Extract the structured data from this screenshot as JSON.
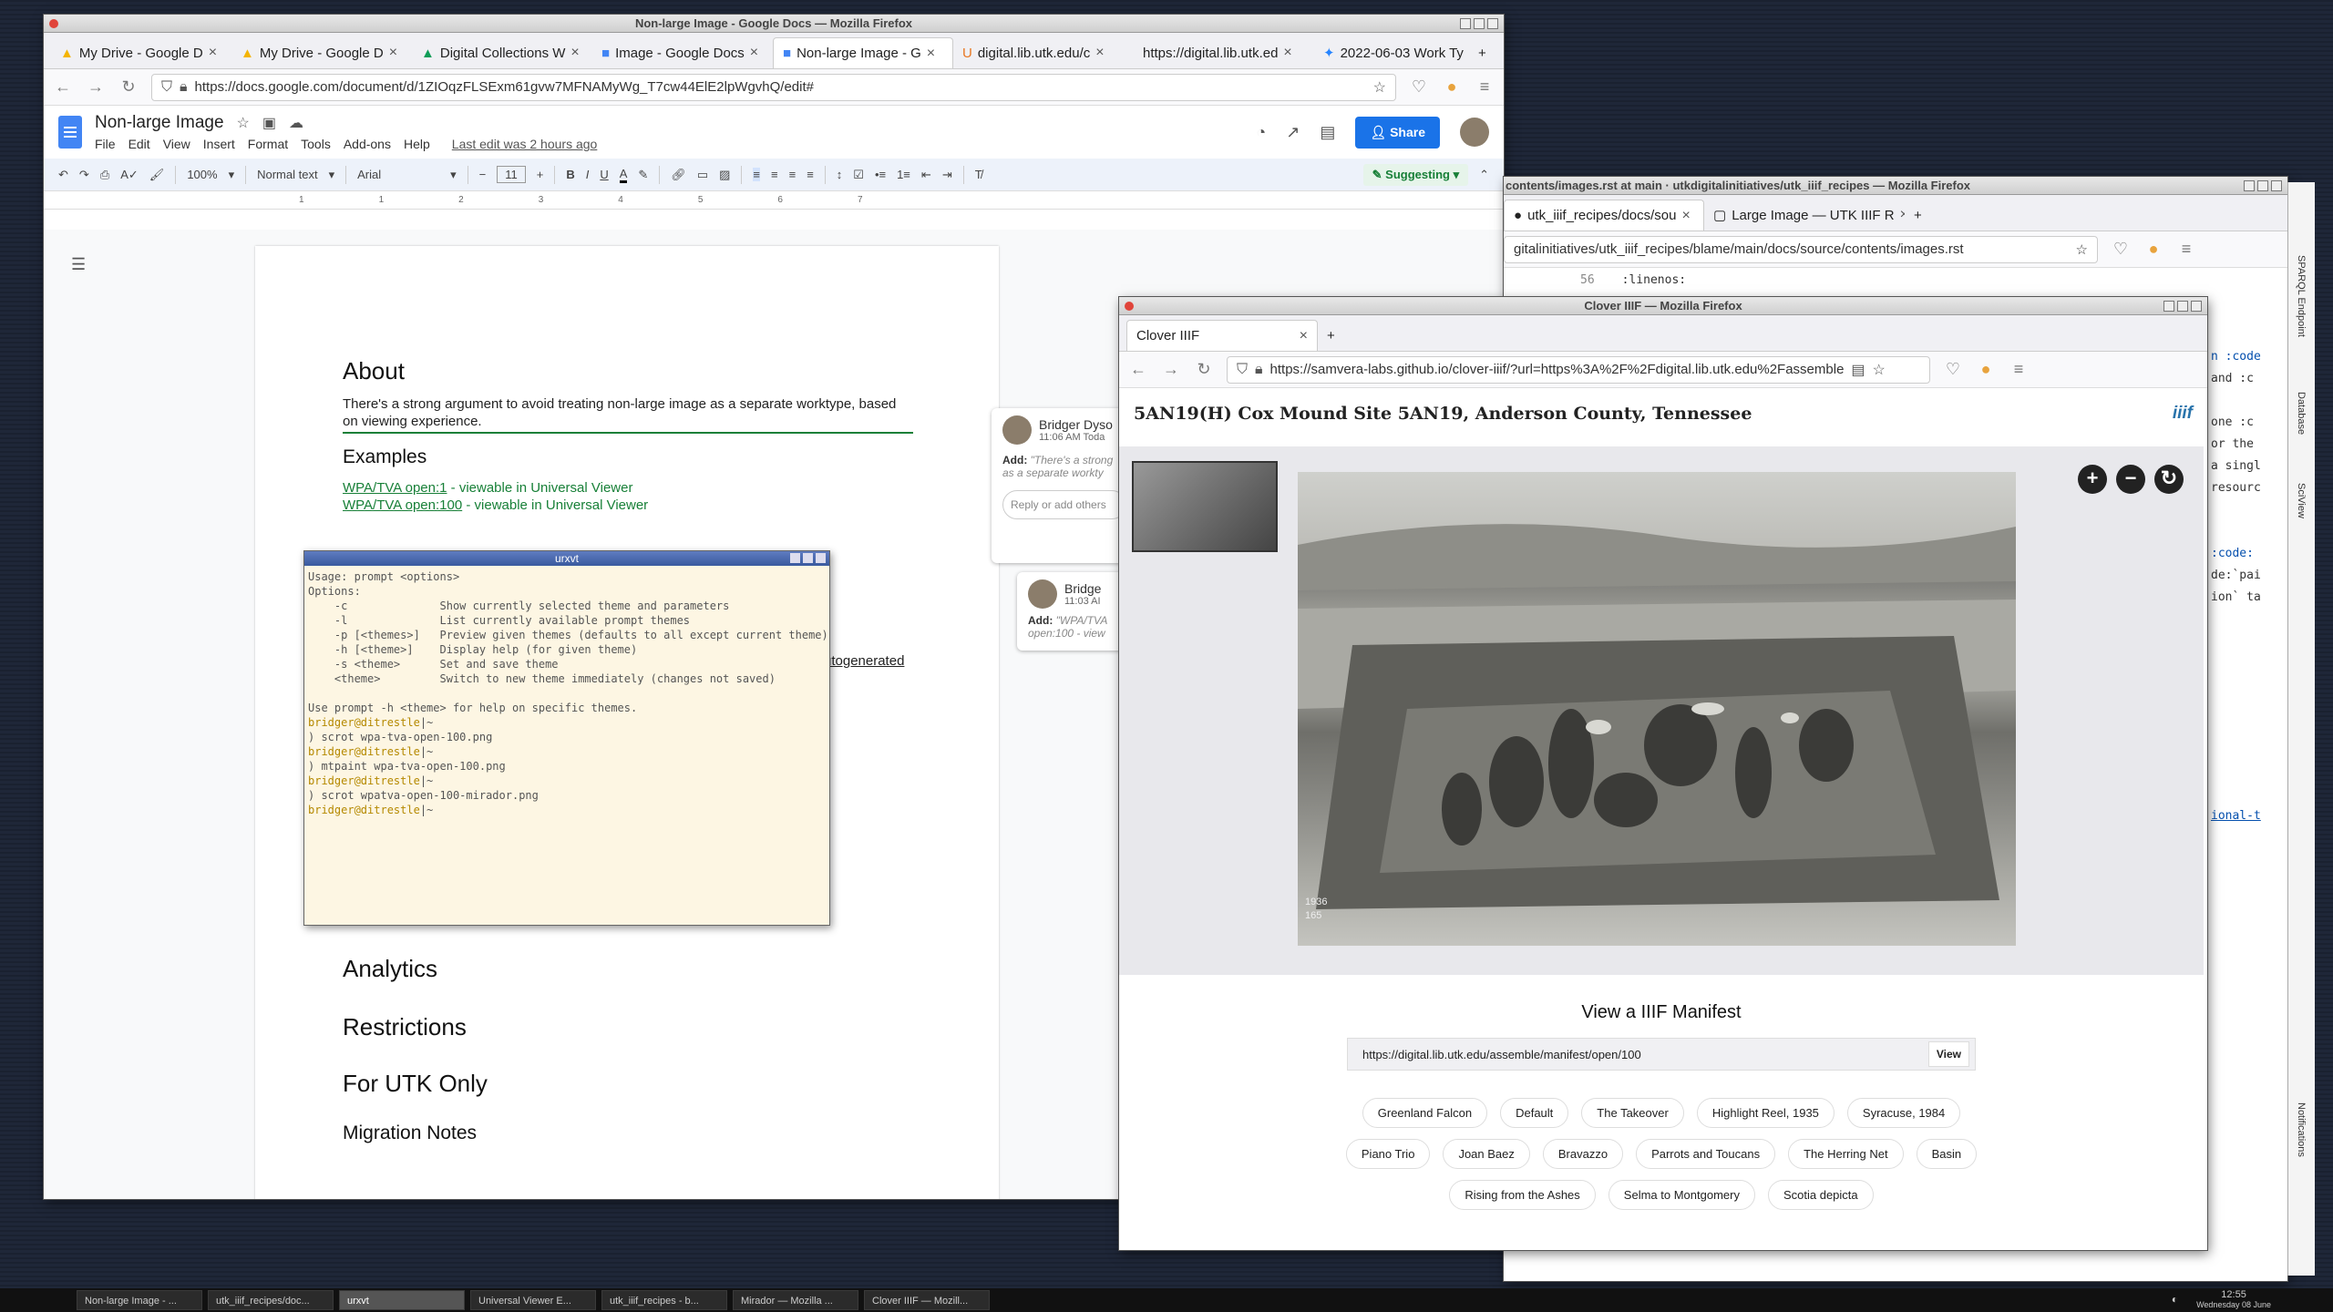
{
  "docs": {
    "window_title": "Non-large Image - Google Docs — Mozilla Firefox",
    "tabs": [
      {
        "label": "My Drive - Google D"
      },
      {
        "label": "My Drive - Google D"
      },
      {
        "label": "Digital Collections W"
      },
      {
        "label": "Image - Google Docs"
      },
      {
        "label": "Non-large Image - G"
      },
      {
        "label": "digital.lib.utk.edu/c"
      },
      {
        "label": "https://digital.lib.utk.ed"
      },
      {
        "label": "2022-06-03 Work Ty"
      }
    ],
    "url": "https://docs.google.com/document/d/1ZIOqzFLSExm61gvw7MFNAMyWg_T7cw44ElE2lpWgvhQ/edit#",
    "doc_title": "Non-large Image",
    "menu": [
      "File",
      "Edit",
      "View",
      "Insert",
      "Format",
      "Tools",
      "Add-ons",
      "Help"
    ],
    "last_edit": "Last edit was 2 hours ago",
    "share_label": "Share",
    "toolbar": {
      "zoom": "100%",
      "style": "Normal text",
      "font": "Arial",
      "size": "11",
      "mode": "Suggesting"
    },
    "ruler": [
      "1",
      "1",
      "2",
      "3",
      "4",
      "5",
      "6",
      "7"
    ],
    "body": {
      "about_heading": "About",
      "about_text": "There's a strong argument to avoid treating non-large image as a separate worktype, based on viewing experience.",
      "examples_heading": "Examples",
      "example1_link": "WPA/TVA open:1",
      "example1_text": " - viewable in Universal Viewer",
      "example2_link": "WPA/TVA open:100",
      "example2_text": " - viewable in Universal Viewer",
      "autogen_text": "utogenerated",
      "analytics_heading": "Analytics",
      "restrictions_heading": "Restrictions",
      "utk_heading": "For UTK Only",
      "migration_heading": "Migration Notes"
    },
    "comments": [
      {
        "author": "Bridger Dyso",
        "time": "11:06 AM Toda",
        "add_label": "Add:",
        "text": "\"There's a strong",
        "text2": "as a separate workty",
        "reply": "Reply or add others"
      },
      {
        "author": "Bridge",
        "time": "11:03 AI",
        "add_label": "Add:",
        "text": "\"WPA/TVA",
        "text2": "open:100 - view"
      }
    ]
  },
  "terminal": {
    "title": "urxvt",
    "lines": [
      "Usage: prompt <options>",
      "Options:",
      "    -c              Show currently selected theme and parameters",
      "    -l              List currently available prompt themes",
      "    -p [<themes>]   Preview given themes (defaults to all except current theme)",
      "    -h [<theme>]    Display help (for given theme)",
      "    -s <theme>      Set and save theme",
      "    <theme>         Switch to new theme immediately (changes not saved)",
      "",
      "Use prompt -h <theme> for help on specific themes."
    ],
    "prompt": "bridger@ditrestle",
    "prompt_suffix": "|~",
    "commands": [
      ") scrot wpa-tva-open-100.png",
      ") mtpaint wpa-tva-open-100.png",
      ") scrot wpatva-open-100-mirador.png"
    ]
  },
  "github": {
    "window_title": "contents/images.rst at main · utkdigitalinitiatives/utk_iiif_recipes — Mozilla Firefox",
    "tabs": [
      {
        "label": "utk_iiif_recipes/docs/sou"
      },
      {
        "label": "Large Image — UTK IIIF R"
      }
    ],
    "url": "gitalinitiatives/utk_iiif_recipes/blame/main/docs/source/contents/images.rst",
    "line_no": "56",
    "line_code": ":linenos:",
    "right_snippets": [
      "n :code",
      "and :c",
      "one :c",
      "or the",
      "a singl",
      "resourc",
      ":code:",
      "de:`pai",
      "ion` ta",
      "ional-t"
    ]
  },
  "side_panel": {
    "labels": [
      "SPARQL Endpoint",
      "Database",
      "SciView",
      "Notifications"
    ]
  },
  "clover": {
    "window_title": "Clover IIIF — Mozilla Firefox",
    "tab_label": "Clover IIIF",
    "url": "https://samvera-labs.github.io/clover-iiif/?url=https%3A%2F%2Fdigital.lib.utk.edu%2Fassemble",
    "heading": "5AN19(H) Cox Mound Site 5AN19, Anderson County, Tennessee",
    "logo_text": "iiif",
    "photo_caption": "1936\n165",
    "manifest_heading": "View a IIIF Manifest",
    "manifest_value": "https://digital.lib.utk.edu/assemble/manifest/open/100",
    "view_label": "View",
    "chips": [
      "Greenland Falcon",
      "Default",
      "The Takeover",
      "Highlight Reel, 1935",
      "Syracuse, 1984",
      "Piano Trio",
      "Joan Baez",
      "Bravazzo",
      "Parrots and Toucans",
      "The Herring Net",
      "Basin",
      "Rising from the Ashes",
      "Selma to Montgomery",
      "Scotia depicta"
    ]
  },
  "taskbar": {
    "items": [
      "Non-large Image - ...",
      "utk_iiif_recipes/doc...",
      "urxvt",
      "Universal Viewer E...",
      "utk_iiif_recipes - b...",
      "Mirador — Mozilla ...",
      "Clover IIIF — Mozill..."
    ],
    "time": "12:55",
    "date": "Wednesday 08 June"
  }
}
